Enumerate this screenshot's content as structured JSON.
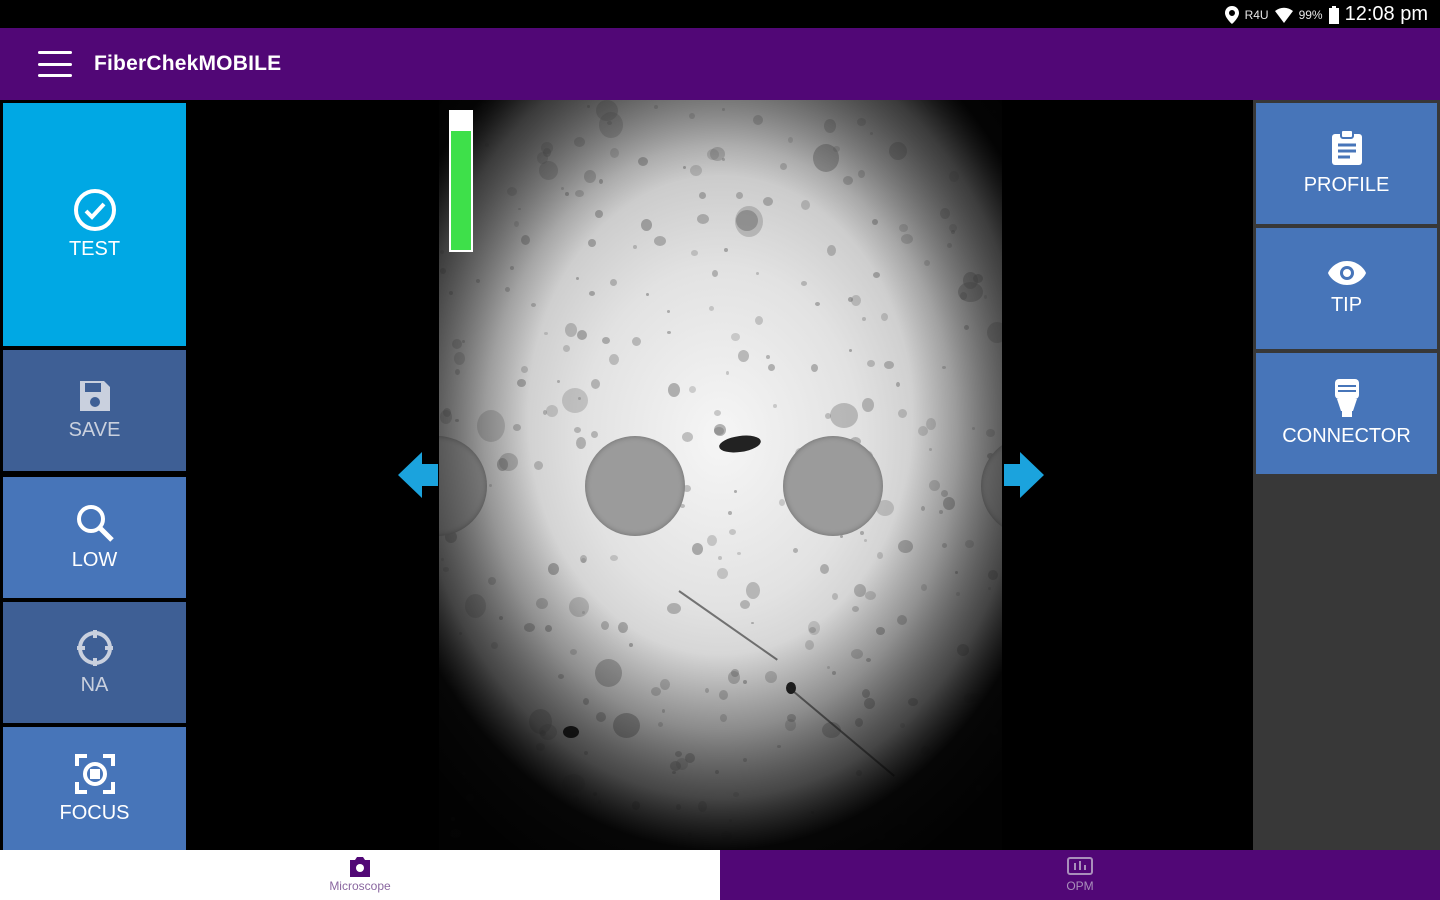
{
  "status_bar": {
    "signal": "R4U",
    "battery": "99%",
    "time": "12:08 pm"
  },
  "app_bar": {
    "title": "FiberChekMOBILE"
  },
  "left_buttons": {
    "test": "TEST",
    "save": "SAVE",
    "low": "LOW",
    "na": "NA",
    "focus": "FOCUS"
  },
  "right_buttons": {
    "profile": "PROFILE",
    "tip": "TIP",
    "connector": "CONNECTOR"
  },
  "viewer": {
    "focus_level_percent": 86,
    "level_color": "#3ee04a"
  },
  "bottom_tabs": {
    "microscope": "Microscope",
    "opm": "OPM",
    "active": "Microscope"
  },
  "colors": {
    "app_bar": "#510776",
    "test_active": "#00a8e4",
    "button_blue": "#4775b9",
    "button_dim": "#3e5f95",
    "arrow": "#1ba3dd"
  }
}
